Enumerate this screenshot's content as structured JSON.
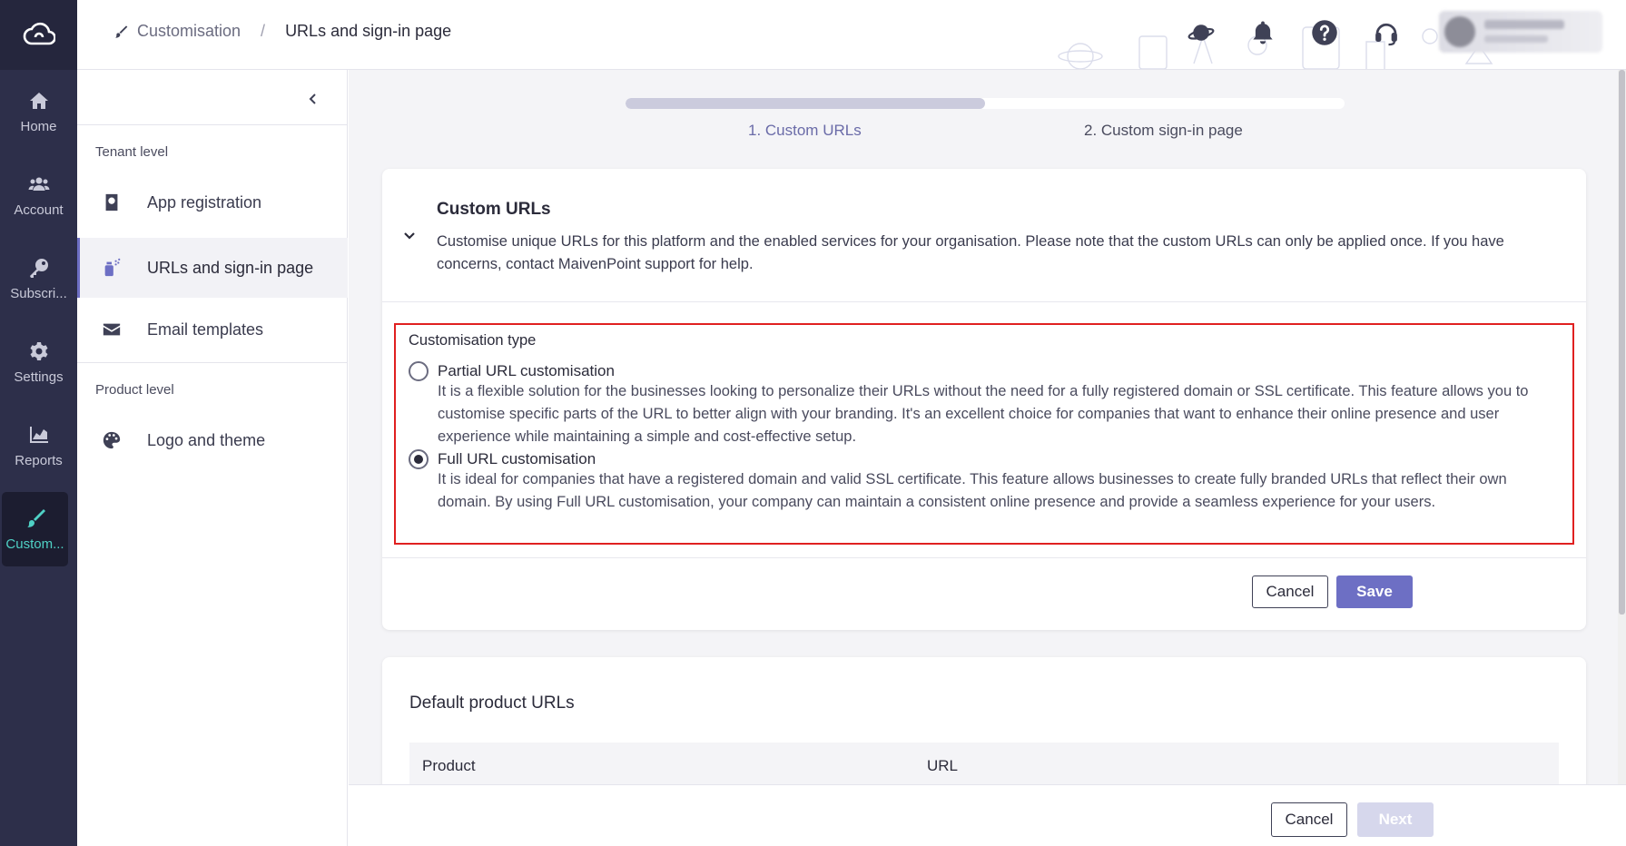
{
  "rail": {
    "items": [
      {
        "label": "Home",
        "icon": "home-icon"
      },
      {
        "label": "Account",
        "icon": "users-icon"
      },
      {
        "label": "Subscri...",
        "icon": "key-icon"
      },
      {
        "label": "Settings",
        "icon": "gear-icon"
      },
      {
        "label": "Reports",
        "icon": "chart-icon"
      },
      {
        "label": "Custom...",
        "icon": "brush-icon",
        "active": true
      }
    ]
  },
  "header": {
    "breadcrumb": {
      "parent": "Customisation",
      "separator": "/",
      "current": "URLs and sign-in page"
    },
    "icons": [
      "planet-icon",
      "bell-icon",
      "help-icon",
      "headset-icon"
    ]
  },
  "subnav": {
    "tenant_title": "Tenant level",
    "items": [
      {
        "label": "App registration",
        "icon": "passport-icon"
      },
      {
        "label": "URLs and sign-in page",
        "icon": "spray-icon",
        "active": true
      },
      {
        "label": "Email templates",
        "icon": "envelope-icon"
      }
    ],
    "product_title": "Product level",
    "product_items": [
      {
        "label": "Logo and theme",
        "icon": "palette-icon"
      }
    ]
  },
  "steps": {
    "progress": 0.5,
    "step1": "1. Custom URLs",
    "step2": "2. Custom sign-in page"
  },
  "custom_urls": {
    "title": "Custom URLs",
    "description": "Customise unique URLs for this platform and the enabled services for your organisation. Please note that the custom URLs can only be applied once. If you have concerns, contact MaivenPoint support for help.",
    "type_label": "Customisation type",
    "options": [
      {
        "title": "Partial URL customisation",
        "description": "It is a flexible solution for the businesses looking to personalize their URLs without the need for a fully registered domain or SSL certificate. This feature allows you to customise specific parts of the URL to better align with your branding. It's an excellent choice for companies that want to enhance their online presence and user experience while maintaining a simple and cost-effective setup.",
        "checked": false
      },
      {
        "title": "Full URL customisation",
        "description": "It is ideal for companies that have a registered domain and valid SSL certificate. This feature allows businesses to create fully branded URLs that reflect their own domain. By using Full URL customisation, your company can maintain a consistent online presence and provide a seamless experience for your users.",
        "checked": true
      }
    ],
    "cancel_label": "Cancel",
    "save_label": "Save"
  },
  "default_urls": {
    "title": "Default product URLs",
    "columns": [
      "Product",
      "URL"
    ]
  },
  "footer": {
    "cancel_label": "Cancel",
    "next_label": "Next"
  },
  "colors": {
    "accent": "#6d6fc4",
    "rail_bg": "#2d2f4a",
    "rail_active": "#4fd1c5",
    "highlight_border": "#e02020"
  }
}
